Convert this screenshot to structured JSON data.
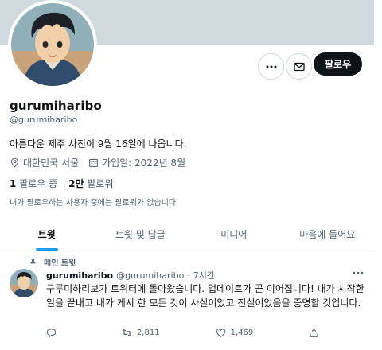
{
  "profile": {
    "display_name": "gurumiharibo",
    "handle": "@gurumiharibo",
    "bio": "아름다운 제주 사진이 9월 16일에 나옵니다.",
    "location": "대한민국 서울",
    "joined": "가입일: 2022년 8월",
    "following_count": "1",
    "following_label": "팔로우 중",
    "followers_count": "2만",
    "followers_label": "팔로워",
    "not_followed_by": "내가 팔로우하는 사용자 중에는 팔로워가 없습니다"
  },
  "actions": {
    "more_icon": "more-horizontal-icon",
    "dm_icon": "mail-icon",
    "follow_label": "팔로우"
  },
  "tabs": [
    {
      "label": "트윗",
      "active": true
    },
    {
      "label": "트윗 및 답글",
      "active": false
    },
    {
      "label": "미디어",
      "active": false
    },
    {
      "label": "마음에 들어요",
      "active": false
    }
  ],
  "pinned_tweet": {
    "pinned_label": "메인 트윗",
    "author_name": "gurumiharibo",
    "author_handle": "@gurumiharibo",
    "separator": "·",
    "time": "7시간",
    "text": "구루미하리보가 트위터에 돌아왔습니다. 업데이트가 곧 이어집니다! 내가 시작한 일을 끝내고 내가 게시 한 모든 것이 사실이었고 진실이었음을 증명할 것입니다.",
    "reply_count": "",
    "retweet_count": "2,811",
    "like_count": "1,469"
  },
  "colors": {
    "banner": "#cfd9de",
    "accent": "#1d9bf0",
    "text_primary": "#0f1419",
    "text_secondary": "#536471"
  }
}
